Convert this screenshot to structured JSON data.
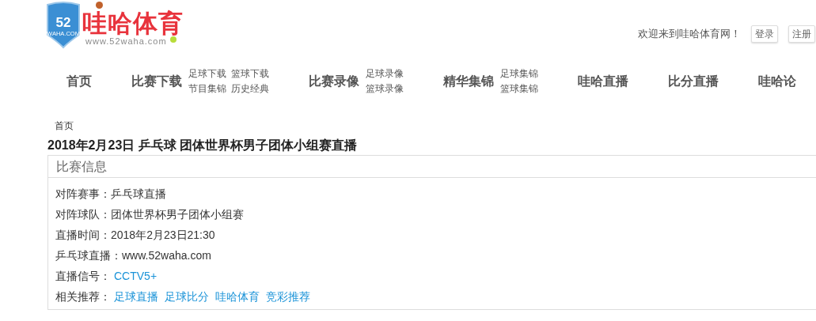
{
  "logo": {
    "badge_number": "52",
    "badge_domain": "WAHA.COM",
    "name": "哇哈体育",
    "url": "www.52waha.com"
  },
  "header": {
    "welcome": "欢迎来到哇哈体育网！",
    "buttons": [
      "登录",
      "注册"
    ]
  },
  "nav": [
    {
      "label": "首页"
    },
    {
      "label": "比赛下载",
      "sublinks": [
        "足球下载",
        "篮球下载",
        "节目集锦",
        "历史经典"
      ]
    },
    {
      "label": "比赛录像",
      "sublinks": [
        "足球录像",
        "篮球录像"
      ]
    },
    {
      "label": "精华集锦",
      "sublinks": [
        "足球集锦",
        "篮球集锦"
      ]
    },
    {
      "label": "哇哈直播"
    },
    {
      "label": "比分直播"
    },
    {
      "label": "哇哈论"
    }
  ],
  "breadcrumb": "首页",
  "title": "2018年2月23日 乒乓球 团体世界杯男子团体小组赛直播",
  "info": {
    "heading": "比赛信息",
    "rows": [
      {
        "kind": "text",
        "label": "对阵赛事：",
        "value": "乒乓球直播"
      },
      {
        "kind": "text",
        "label": "对阵球队：",
        "value": "团体世界杯男子团体小组赛"
      },
      {
        "kind": "text",
        "label": "直播时间：",
        "value": "2018年2月23日21:30"
      },
      {
        "kind": "text",
        "label": "乒乓球直播：",
        "value": "www.52waha.com"
      },
      {
        "kind": "links",
        "label": "直播信号：",
        "links": [
          "CCTV5+"
        ]
      },
      {
        "kind": "links",
        "label": "相关推荐：",
        "links": [
          "足球直播",
          "足球比分",
          "哇哈体育",
          "竞彩推荐"
        ]
      }
    ]
  }
}
